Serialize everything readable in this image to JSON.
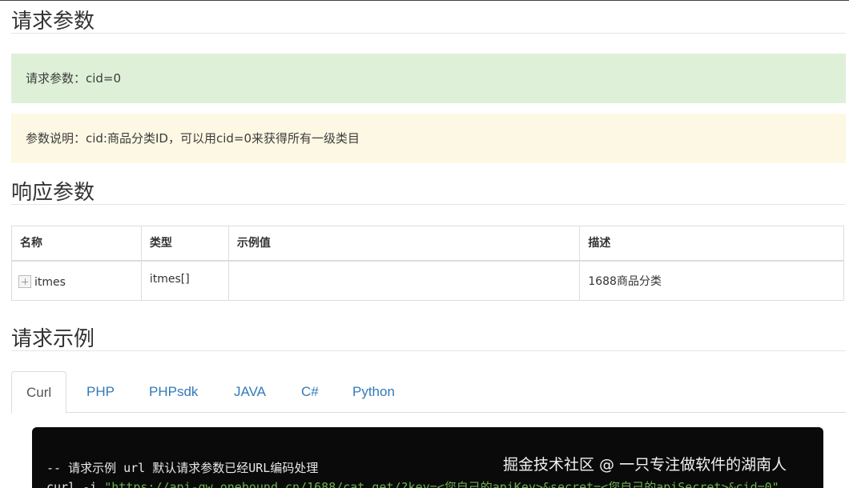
{
  "sections": {
    "request_params_title": "请求参数",
    "response_params_title": "响应参数",
    "request_example_title": "请求示例"
  },
  "alerts": {
    "request_params": "请求参数：cid=0",
    "param_description": "参数说明：cid:商品分类ID，可以用cid=0来获得所有一级类目"
  },
  "table": {
    "headers": [
      "名称",
      "类型",
      "示例值",
      "描述"
    ],
    "rows": [
      {
        "name": "itmes",
        "type": "itmes[]",
        "example": "",
        "description": "1688商品分类"
      }
    ]
  },
  "tabs": [
    {
      "label": "Curl",
      "active": true
    },
    {
      "label": "PHP",
      "active": false
    },
    {
      "label": "PHPsdk",
      "active": false
    },
    {
      "label": "JAVA",
      "active": false
    },
    {
      "label": "C#",
      "active": false
    },
    {
      "label": "Python",
      "active": false
    }
  ],
  "code": {
    "comment": "-- 请求示例 url 默认请求参数已经URL编码处理",
    "command_prefix": "curl -i ",
    "command_url": "\"https://api-gw.onebound.cn/1688/cat_get/?key=<您自己的apiKey>&secret=<您自己的apiSecret>&cid=0\""
  },
  "watermark": "掘金技术社区 @ 一只专注做软件的湖南人",
  "colors": {
    "success_bg": "#dff0d8",
    "warning_bg": "#fcf8e3",
    "tab_link": "#337ab7",
    "code_bg": "#0a0a0a",
    "code_string": "#6ab04c"
  }
}
